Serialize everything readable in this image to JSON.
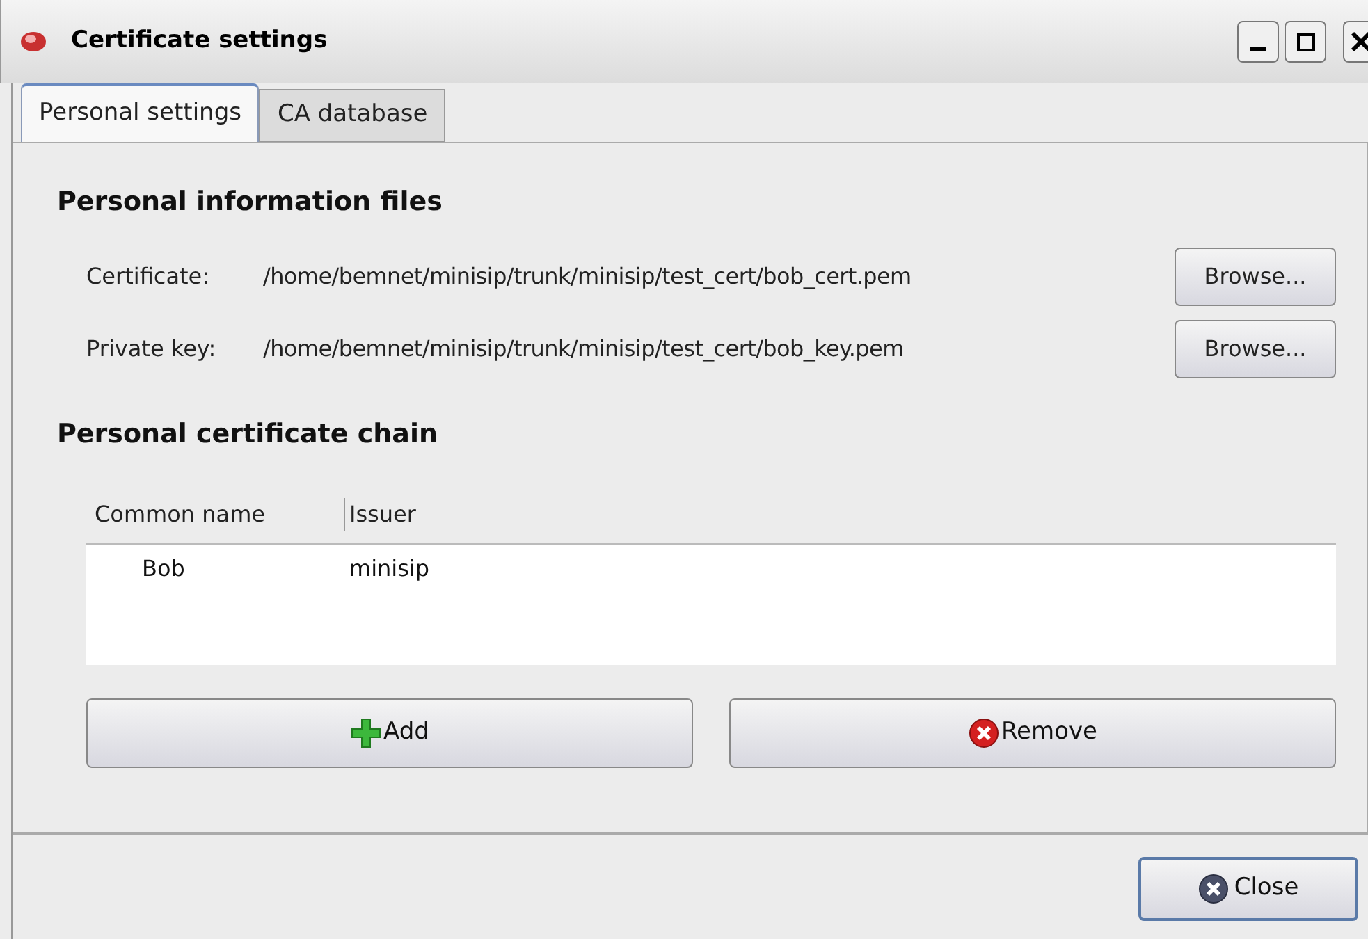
{
  "window": {
    "title": "Certificate settings"
  },
  "tabs": [
    {
      "label": "Personal settings",
      "selected": true
    },
    {
      "label": "CA database",
      "selected": false
    }
  ],
  "files": {
    "heading": "Personal information files",
    "rows": [
      {
        "label": "Certificate:",
        "path": "/home/bemnet/minisip/trunk/minisip/test_cert/bob_cert.pem",
        "button": "Browse..."
      },
      {
        "label": "Private key:",
        "path": "/home/bemnet/minisip/trunk/minisip/test_cert/bob_key.pem",
        "button": "Browse..."
      }
    ]
  },
  "chain": {
    "heading": "Personal certificate chain",
    "columns": [
      "Common name",
      "Issuer"
    ],
    "rows": [
      [
        "Bob",
        "minisip"
      ]
    ]
  },
  "buttons": [
    {
      "kind": "add",
      "label": "Add"
    },
    {
      "kind": "remove",
      "label": "Remove"
    }
  ],
  "close_button": {
    "label": "Close"
  }
}
